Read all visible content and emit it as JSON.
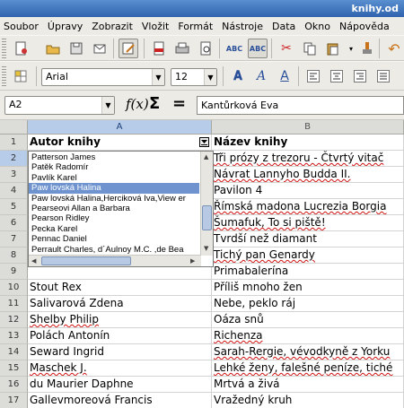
{
  "window": {
    "title": "knihy.od"
  },
  "menu": [
    "Soubor",
    "Úpravy",
    "Zobrazit",
    "Vložit",
    "Formát",
    "Nástroje",
    "Data",
    "Okno",
    "Nápověda"
  ],
  "formatting": {
    "font_name": "Arial",
    "font_size": "12"
  },
  "formula_bar": {
    "name_box": "A2",
    "content": "Kantůrková Eva"
  },
  "columns": [
    "A",
    "B"
  ],
  "rows": [
    {
      "n": "1",
      "a": "Autor knihy",
      "b": "Název knihy"
    },
    {
      "n": "2",
      "a": "",
      "b": "Tři prózy z trezoru - Čtvrtý vitač"
    },
    {
      "n": "3",
      "a": "",
      "b": "Návrat Lannyho Budda II."
    },
    {
      "n": "4",
      "a": "",
      "b": "Pavilon 4"
    },
    {
      "n": "5",
      "a": "",
      "b": "Římská madona Lucrezia Borgia"
    },
    {
      "n": "6",
      "a": "",
      "b": "Šumafuk, To si piště!"
    },
    {
      "n": "7",
      "a": "",
      "b": "Tvrdší než diamant"
    },
    {
      "n": "8",
      "a": "",
      "b": "Tichý pan Genardy"
    },
    {
      "n": "9",
      "a": "",
      "b": "Primabalerína"
    },
    {
      "n": "10",
      "a": "Stout Rex",
      "b": "Příliš mnoho žen"
    },
    {
      "n": "11",
      "a": "Salivarová Zdena",
      "b": "Nebe, peklo ráj"
    },
    {
      "n": "12",
      "a": "Shelby Philip",
      "b": "Oáza snů"
    },
    {
      "n": "13",
      "a": "Polách Antonín",
      "b": "Richenza"
    },
    {
      "n": "14",
      "a": "Seward Ingrid",
      "b": "Sarah-Rergie, vévodkyně z Yorku"
    },
    {
      "n": "15",
      "a": "Maschek J.",
      "b": "Lehké ženy, falešné peníze, tiché"
    },
    {
      "n": "16",
      "a": "du Maurier Daphne",
      "b": "Mrtvá a živá"
    },
    {
      "n": "17",
      "a": "Gallevmoreová Francis",
      "b": "Vražedný kruh"
    }
  ],
  "dropdown": {
    "items": [
      "Patterson James",
      "Patěk Radomír",
      "Pavlík Karel",
      "Paw lovská Halina",
      "Paw lovská Halina,Herciková Iva,View er",
      "Pearseovi Allan a Barbara",
      "Pearson Ridley",
      "Pecka Karel",
      "Pennac Daniel",
      "Perrault Charles, d´Aulnoy M.C. ,de Bea"
    ],
    "selected_index": 3
  }
}
